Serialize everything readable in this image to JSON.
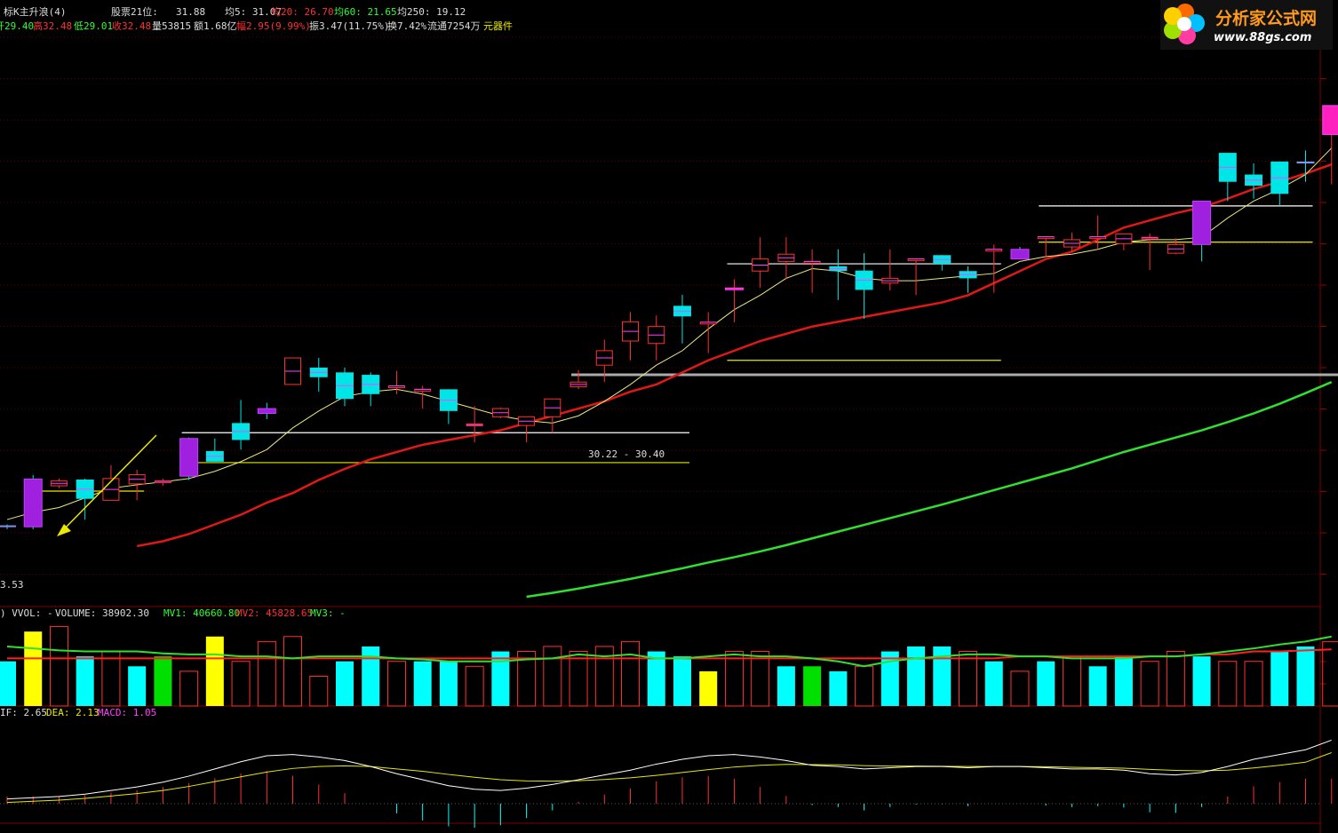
{
  "header": {
    "title": "标K主升浪(4)",
    "price_label": "股票21位:",
    "price_value": "31.88",
    "ma5": "均5: 31.07",
    "ma20": "均20: 26.70",
    "ma60": "均60: 21.65",
    "ma250": "均250: 19.12",
    "open": "开29.40",
    "high": "高32.48",
    "low": "低29.01",
    "close": "收32.48",
    "volume": "量53815",
    "amount": "额1.68亿",
    "change": "幅2.95(9.99%)",
    "amplitude": "振3.47(11.75%)",
    "turnover": "换7.42%",
    "float": "流通7254万",
    "sector": "元器件"
  },
  "logo": {
    "title": "分析家公式网",
    "url": "www.88gs.com"
  },
  "vol_panel": {
    "prefix": ") VVOL: - ",
    "volume": "VOLUME: 38902.30",
    "mv1": "MV1: 40660.80",
    "mv2": "MV2: 45828.65",
    "mv3": "MV3: -"
  },
  "macd_panel": {
    "dif": "IF: 2.65",
    "dea": "DEA: 2.13",
    "macd": "MACD: 1.05"
  },
  "annotations": {
    "left_price": "3.53",
    "band_label": "30.22 - 30.40"
  },
  "chart_data": {
    "type": "candlestick",
    "ylim": [
      22.3,
      33.6
    ],
    "candles": [
      [
        23.78,
        23.8,
        23.7,
        23.75
      ],
      [
        24.74,
        24.82,
        23.7,
        23.75
      ],
      [
        24.6,
        24.75,
        24.55,
        24.7
      ],
      [
        24.73,
        24.75,
        23.9,
        24.33
      ],
      [
        24.3,
        25.03,
        24.3,
        24.75
      ],
      [
        24.64,
        24.93,
        24.3,
        24.83
      ],
      [
        24.68,
        24.75,
        24.6,
        24.7
      ],
      [
        25.58,
        25.6,
        24.72,
        24.8
      ],
      [
        25.32,
        25.58,
        25.1,
        25.1
      ],
      [
        25.9,
        26.38,
        25.35,
        25.55
      ],
      [
        26.2,
        26.32,
        25.98,
        26.1
      ],
      [
        26.7,
        27.25,
        26.7,
        27.25
      ],
      [
        27.05,
        27.25,
        26.55,
        26.85
      ],
      [
        26.95,
        27.05,
        26.25,
        26.4
      ],
      [
        26.9,
        26.95,
        26.25,
        26.5
      ],
      [
        26.67,
        26.98,
        26.5,
        26.67
      ],
      [
        26.6,
        26.67,
        26.2,
        26.6
      ],
      [
        26.6,
        26.6,
        25.88,
        26.15
      ],
      [
        25.85,
        26.25,
        25.5,
        25.88
      ],
      [
        26.03,
        26.22,
        26.0,
        26.2
      ],
      [
        25.85,
        26.03,
        25.5,
        26.03
      ],
      [
        26.03,
        26.4,
        25.7,
        26.4
      ],
      [
        26.65,
        27.0,
        26.6,
        26.75
      ],
      [
        27.1,
        27.63,
        26.75,
        27.4
      ],
      [
        27.6,
        28.2,
        27.2,
        28.0
      ],
      [
        27.55,
        28.13,
        27.2,
        27.9
      ],
      [
        28.33,
        28.56,
        27.55,
        28.11
      ],
      [
        27.99,
        28.2,
        27.35,
        27.99
      ],
      [
        28.7,
        28.88,
        27.99,
        28.7
      ],
      [
        29.05,
        29.75,
        28.7,
        29.3
      ],
      [
        29.25,
        29.75,
        28.88,
        29.4
      ],
      [
        29.25,
        29.5,
        28.6,
        29.25
      ],
      [
        29.15,
        29.5,
        28.45,
        29.05
      ],
      [
        29.06,
        29.42,
        28.06,
        28.66
      ],
      [
        28.8,
        29.5,
        28.65,
        28.9
      ],
      [
        29.3,
        29.3,
        28.55,
        29.3
      ],
      [
        29.38,
        29.38,
        29.06,
        29.2
      ],
      [
        29.05,
        29.15,
        28.6,
        28.9
      ],
      [
        29.5,
        29.6,
        28.6,
        29.5
      ],
      [
        29.5,
        29.55,
        29.3,
        29.3
      ],
      [
        29.76,
        29.76,
        29.35,
        29.76
      ],
      [
        29.55,
        29.85,
        29.45,
        29.7
      ],
      [
        29.76,
        30.2,
        29.5,
        29.76
      ],
      [
        29.62,
        29.82,
        29.48,
        29.82
      ],
      [
        29.73,
        29.83,
        29.07,
        29.75
      ],
      [
        29.42,
        29.73,
        29.4,
        29.6
      ],
      [
        30.5,
        30.5,
        29.25,
        29.6
      ],
      [
        31.5,
        31.5,
        30.5,
        30.9
      ],
      [
        31.05,
        31.28,
        30.55,
        30.82
      ],
      [
        31.32,
        31.32,
        30.4,
        30.65
      ],
      [
        31.32,
        31.55,
        30.9,
        31.28
      ],
      [
        31.88,
        32.48,
        30.85,
        32.48
      ]
    ],
    "ma_yellow": [
      23.9,
      24.05,
      24.15,
      24.35,
      24.55,
      24.62,
      24.68,
      24.75,
      24.9,
      25.1,
      25.35,
      25.8,
      26.15,
      26.45,
      26.55,
      26.6,
      26.5,
      26.35,
      26.2,
      26.05,
      25.95,
      25.9,
      26.05,
      26.35,
      26.7,
      27.1,
      27.4,
      27.85,
      28.25,
      28.55,
      28.9,
      29.1,
      29.05,
      28.9,
      28.85,
      28.85,
      28.9,
      28.95,
      29.0,
      29.25,
      29.35,
      29.4,
      29.5,
      29.65,
      29.7,
      29.7,
      29.75,
      30.15,
      30.5,
      30.75,
      31.05,
      31.6
    ],
    "ma_red": [
      null,
      null,
      null,
      null,
      null,
      23.35,
      23.45,
      23.6,
      23.8,
      24.0,
      24.25,
      24.45,
      24.72,
      24.95,
      25.15,
      25.3,
      25.45,
      25.55,
      25.65,
      25.75,
      25.9,
      26.05,
      26.2,
      26.35,
      26.55,
      26.7,
      26.95,
      27.2,
      27.4,
      27.6,
      27.75,
      27.9,
      28.0,
      28.1,
      28.2,
      28.3,
      28.4,
      28.55,
      28.8,
      29.05,
      29.3,
      29.45,
      29.7,
      29.95,
      30.1,
      30.25,
      30.37,
      30.55,
      30.75,
      30.9,
      31.07,
      31.26
    ],
    "ma_green": [
      null,
      null,
      null,
      null,
      null,
      null,
      null,
      null,
      null,
      null,
      null,
      null,
      null,
      null,
      null,
      null,
      null,
      null,
      null,
      null,
      22.3,
      22.38,
      22.47,
      22.57,
      22.67,
      22.78,
      22.89,
      23.01,
      23.12,
      23.24,
      23.37,
      23.51,
      23.65,
      23.79,
      23.93,
      24.07,
      24.21,
      24.36,
      24.51,
      24.66,
      24.81,
      24.96,
      25.13,
      25.3,
      25.45,
      25.6,
      25.75,
      25.92,
      26.1,
      26.3,
      26.52,
      26.75
    ],
    "h_lines": [
      {
        "y": 24.49,
        "from": 1,
        "to": 5,
        "color": "#e8e800"
      },
      {
        "y": 25.08,
        "from": 7,
        "to": 26,
        "color": "#e8e800"
      },
      {
        "y": 25.7,
        "from": 7,
        "to": 26,
        "color": "#ffffff"
      },
      {
        "y": 27.2,
        "from": 28,
        "to": 38,
        "color": "#e8e800"
      },
      {
        "y": 26.9,
        "from": 22,
        "to": 52,
        "color": "#aaaaaa"
      },
      {
        "y": 29.2,
        "from": 28,
        "to": 38,
        "color": "#ffffff"
      },
      {
        "y": 30.4,
        "from": 40,
        "to": 50,
        "color": "#ffffff"
      },
      {
        "y": 29.65,
        "from": 40,
        "to": 50,
        "color": "#e8e800"
      }
    ],
    "volume": [
      45,
      75,
      80,
      50,
      55,
      40,
      50,
      35,
      70,
      45,
      65,
      70,
      30,
      45,
      60,
      45,
      45,
      45,
      40,
      55,
      55,
      60,
      55,
      60,
      65,
      55,
      50,
      35,
      55,
      55,
      40,
      40,
      35,
      40,
      55,
      60,
      60,
      55,
      45,
      35,
      45,
      50,
      40,
      50,
      45,
      55,
      50,
      45,
      45,
      55,
      60,
      65
    ],
    "vol_colors": [
      "cyan",
      "yellow",
      "red",
      "cyan",
      "red",
      "cyan",
      "green",
      "red",
      "yellow",
      "red",
      "red",
      "red",
      "red",
      "cyan",
      "cyan",
      "red",
      "cyan",
      "cyan",
      "red",
      "cyan",
      "red",
      "red",
      "red",
      "red",
      "red",
      "cyan",
      "cyan",
      "yellow",
      "red",
      "red",
      "cyan",
      "green",
      "cyan",
      "red",
      "cyan",
      "cyan",
      "cyan",
      "red",
      "cyan",
      "red",
      "cyan",
      "red",
      "cyan",
      "cyan",
      "red",
      "red",
      "cyan",
      "red",
      "red",
      "cyan",
      "cyan",
      "red"
    ],
    "vol_mv_green": [
      60,
      58,
      56,
      55,
      55,
      55,
      53,
      52,
      52,
      50,
      50,
      48,
      50,
      50,
      50,
      48,
      47,
      45,
      45,
      45,
      47,
      48,
      52,
      50,
      52,
      48,
      48,
      50,
      52,
      50,
      50,
      48,
      45,
      40,
      45,
      48,
      50,
      52,
      52,
      50,
      50,
      48,
      48,
      48,
      50,
      50,
      52,
      55,
      58,
      62,
      65,
      70
    ],
    "vol_mv_red": [
      48,
      48,
      48,
      48,
      48,
      48,
      48,
      48,
      48,
      48,
      48,
      48,
      48,
      48,
      48,
      48,
      48,
      48,
      48,
      48,
      48,
      48,
      48,
      48,
      48,
      48,
      48,
      48,
      48,
      48,
      48,
      48,
      48,
      48,
      48,
      48,
      48,
      48,
      48,
      50,
      50,
      50,
      50,
      50,
      50,
      50,
      52,
      52,
      55,
      55,
      56,
      57
    ],
    "dif": [
      0.2,
      0.25,
      0.3,
      0.4,
      0.55,
      0.7,
      0.9,
      1.15,
      1.45,
      1.75,
      2.0,
      2.05,
      1.95,
      1.8,
      1.55,
      1.25,
      1.0,
      0.75,
      0.6,
      0.55,
      0.65,
      0.8,
      1.0,
      1.2,
      1.4,
      1.65,
      1.85,
      2.0,
      2.05,
      1.95,
      1.8,
      1.6,
      1.55,
      1.45,
      1.5,
      1.55,
      1.55,
      1.5,
      1.55,
      1.55,
      1.5,
      1.45,
      1.45,
      1.4,
      1.25,
      1.2,
      1.3,
      1.55,
      1.85,
      2.05,
      2.25,
      2.65
    ],
    "dea": [
      0.05,
      0.1,
      0.15,
      0.22,
      0.32,
      0.42,
      0.55,
      0.72,
      0.92,
      1.12,
      1.32,
      1.47,
      1.55,
      1.58,
      1.55,
      1.45,
      1.35,
      1.22,
      1.1,
      1.0,
      0.95,
      0.94,
      0.96,
      1.01,
      1.08,
      1.18,
      1.3,
      1.42,
      1.53,
      1.6,
      1.64,
      1.63,
      1.62,
      1.59,
      1.57,
      1.57,
      1.56,
      1.55,
      1.55,
      1.55,
      1.54,
      1.52,
      1.5,
      1.48,
      1.43,
      1.39,
      1.37,
      1.4,
      1.49,
      1.6,
      1.73,
      2.13
    ]
  }
}
